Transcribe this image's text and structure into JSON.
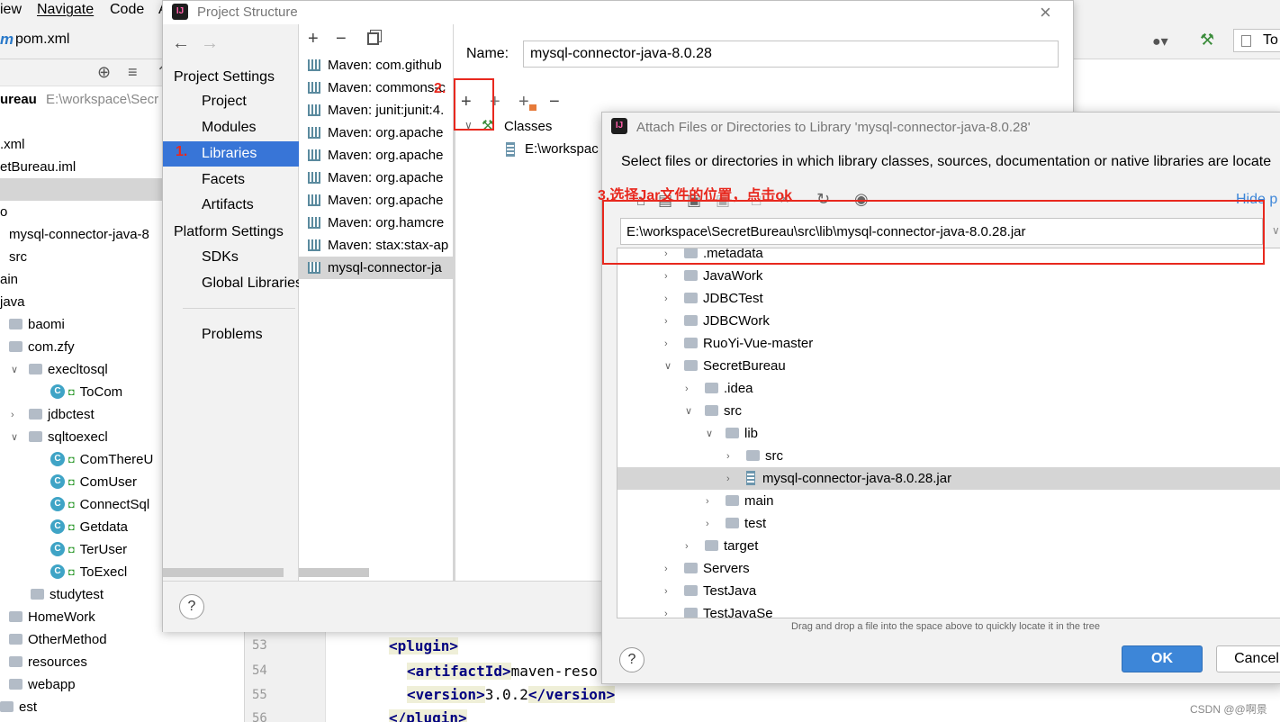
{
  "ide": {
    "menu": [
      "iew",
      "Navigate",
      "Code",
      "A"
    ],
    "file_tab": "pom.xml",
    "toolbar_right_tab": "To",
    "project_root_name": "ureau",
    "project_root_path": "E:\\workspace\\Secr",
    "tree": [
      {
        "label": ".xml",
        "kind": "file"
      },
      {
        "label": "etBureau.iml",
        "kind": "file"
      },
      {
        "label": "",
        "kind": "selected"
      },
      {
        "label": "o",
        "kind": "file"
      },
      {
        "label": "mysql-connector-java-8",
        "kind": "lib"
      },
      {
        "label": "src",
        "kind": "folder"
      },
      {
        "label": "ain",
        "kind": "folder"
      },
      {
        "label": "java",
        "kind": "folder"
      },
      {
        "label": "baomi",
        "kind": "folder"
      },
      {
        "label": "com.zfy",
        "kind": "folder"
      },
      {
        "label": "execltosql",
        "kind": "folder"
      },
      {
        "label": "ToCom",
        "kind": "class"
      },
      {
        "label": "jdbctest",
        "kind": "folder"
      },
      {
        "label": "sqltoexecl",
        "kind": "folder"
      },
      {
        "label": "ComThereU",
        "kind": "class"
      },
      {
        "label": "ComUser",
        "kind": "class"
      },
      {
        "label": "ConnectSql",
        "kind": "class"
      },
      {
        "label": "Getdata",
        "kind": "class"
      },
      {
        "label": "TerUser",
        "kind": "class"
      },
      {
        "label": "ToExecl",
        "kind": "class"
      },
      {
        "label": "studytest",
        "kind": "folder"
      },
      {
        "label": "HomeWork",
        "kind": "folder"
      },
      {
        "label": "OtherMethod",
        "kind": "folder"
      },
      {
        "label": "resources",
        "kind": "folder"
      },
      {
        "label": "webapp",
        "kind": "folder"
      },
      {
        "label": "est",
        "kind": "folder"
      }
    ],
    "editor": {
      "line_numbers": [
        "53",
        "54",
        "55",
        "56"
      ],
      "lines": [
        {
          "open": "<plugin>",
          "text": "",
          "close": ""
        },
        {
          "open": "<artifactId>",
          "text": "maven-reso",
          "close": ""
        },
        {
          "open": "<version>",
          "text": "3.0.2",
          "close": "</version>"
        },
        {
          "open": "</plugin>",
          "text": "",
          "close": ""
        }
      ]
    }
  },
  "project_structure": {
    "title": "Project Structure",
    "sidebar": {
      "project_settings_header": "Project Settings",
      "project_settings": [
        "Project",
        "Modules",
        "Libraries",
        "Facets",
        "Artifacts"
      ],
      "platform_settings_header": "Platform Settings",
      "platform_settings": [
        "SDKs",
        "Global Libraries"
      ],
      "problems": "Problems"
    },
    "libraries": [
      "Maven: com.github",
      "Maven: commons-c",
      "Maven: junit:junit:4.",
      "Maven: org.apache",
      "Maven: org.apache",
      "Maven: org.apache",
      "Maven: org.apache",
      "Maven: org.hamcre",
      "Maven: stax:stax-ap",
      "mysql-connector-ja"
    ],
    "name_label": "Name:",
    "name_value": "mysql-connector-java-8.0.28",
    "classes_label": "Classes",
    "classes_path": "E:\\workspac"
  },
  "annotations": {
    "step1": "1.",
    "step2": "2.",
    "step3": "3.选择Jar文件的位置，点击ok"
  },
  "attach_dialog": {
    "title": "Attach Files or Directories to Library 'mysql-connector-java-8.0.28'",
    "description": "Select files or directories in which library classes, sources, documentation or native libraries are locate",
    "hide_link": "Hide p",
    "path_value": "E:\\workspace\\SecretBureau\\src\\lib\\mysql-connector-java-8.0.28.jar",
    "tree": [
      {
        "label": ".metadata",
        "depth": 0,
        "arrow": "right",
        "kind": "folder"
      },
      {
        "label": "JavaWork",
        "depth": 0,
        "arrow": "right",
        "kind": "folder"
      },
      {
        "label": "JDBCTest",
        "depth": 0,
        "arrow": "right",
        "kind": "folder"
      },
      {
        "label": "JDBCWork",
        "depth": 0,
        "arrow": "right",
        "kind": "folder"
      },
      {
        "label": "RuoYi-Vue-master",
        "depth": 0,
        "arrow": "right",
        "kind": "folder"
      },
      {
        "label": "SecretBureau",
        "depth": 0,
        "arrow": "down",
        "kind": "folder"
      },
      {
        "label": ".idea",
        "depth": 1,
        "arrow": "right",
        "kind": "folder"
      },
      {
        "label": "src",
        "depth": 1,
        "arrow": "down",
        "kind": "folder"
      },
      {
        "label": "lib",
        "depth": 2,
        "arrow": "down",
        "kind": "folder"
      },
      {
        "label": "src",
        "depth": 3,
        "arrow": "right",
        "kind": "folder"
      },
      {
        "label": "mysql-connector-java-8.0.28.jar",
        "depth": 3,
        "arrow": "right",
        "kind": "jar",
        "selected": true
      },
      {
        "label": "main",
        "depth": 2,
        "arrow": "right",
        "kind": "folder"
      },
      {
        "label": "test",
        "depth": 2,
        "arrow": "right",
        "kind": "folder"
      },
      {
        "label": "target",
        "depth": 1,
        "arrow": "right",
        "kind": "folder"
      },
      {
        "label": "Servers",
        "depth": 0,
        "arrow": "right",
        "kind": "folder"
      },
      {
        "label": "TestJava",
        "depth": 0,
        "arrow": "right",
        "kind": "folder"
      },
      {
        "label": "TestJavaSe",
        "depth": 0,
        "arrow": "right",
        "kind": "folder"
      }
    ],
    "drag_hint": "Drag and drop a file into the space above to quickly locate it in the tree",
    "ok_label": "OK",
    "cancel_label": "Cancel"
  },
  "watermark": "CSDN @@啊景",
  "colors": {
    "selection_blue": "#3875d7",
    "annotation_red": "#e8281e",
    "ok_button": "#3d86d8"
  }
}
